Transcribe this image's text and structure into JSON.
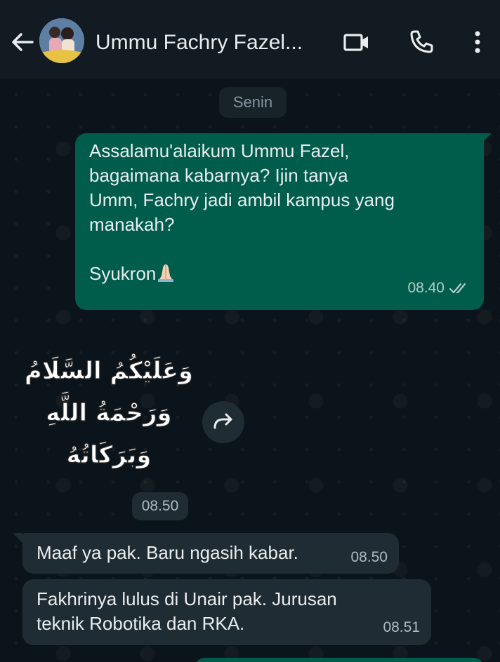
{
  "header": {
    "contact_name": "Ummu Fachry Fazel...",
    "icons": [
      "back-arrow-icon",
      "video-call-icon",
      "voice-call-icon",
      "more-options-icon"
    ]
  },
  "chat": {
    "date_label": "Senin",
    "messages": [
      {
        "direction": "outgoing",
        "text": "Assalamu'alaikum Ummu Fazel,\nbagaimana kabarnya? Ijin tanya\nUmm, Fachry jadi ambil kampus yang\nmanakah?\n\nSyukron",
        "emoji": "folded-hands-icon",
        "time": "08.40",
        "status": "read"
      },
      {
        "direction": "incoming",
        "type": "sticker",
        "sticker_text": [
          "وَعَلَيْكُمُ السَّلَامُ",
          "وَرَحْمَةُ اللَّهِ",
          "وَبَرَكَاتُهُ"
        ],
        "time": "08.50"
      },
      {
        "direction": "incoming",
        "text": "Maaf ya pak. Baru ngasih kabar.",
        "time": "08.50"
      },
      {
        "direction": "incoming",
        "text": "Fakhrinya lulus di Unair pak. Jurusan\nteknik Robotika dan RKA.",
        "time": "08.51"
      }
    ]
  },
  "colors": {
    "background": "#0b141a",
    "header": "#111b21",
    "outgoing_bubble": "#005c4b",
    "incoming_bubble": "#202c33",
    "primary_text": "#e9edef",
    "secondary_text": "#8696a0"
  }
}
